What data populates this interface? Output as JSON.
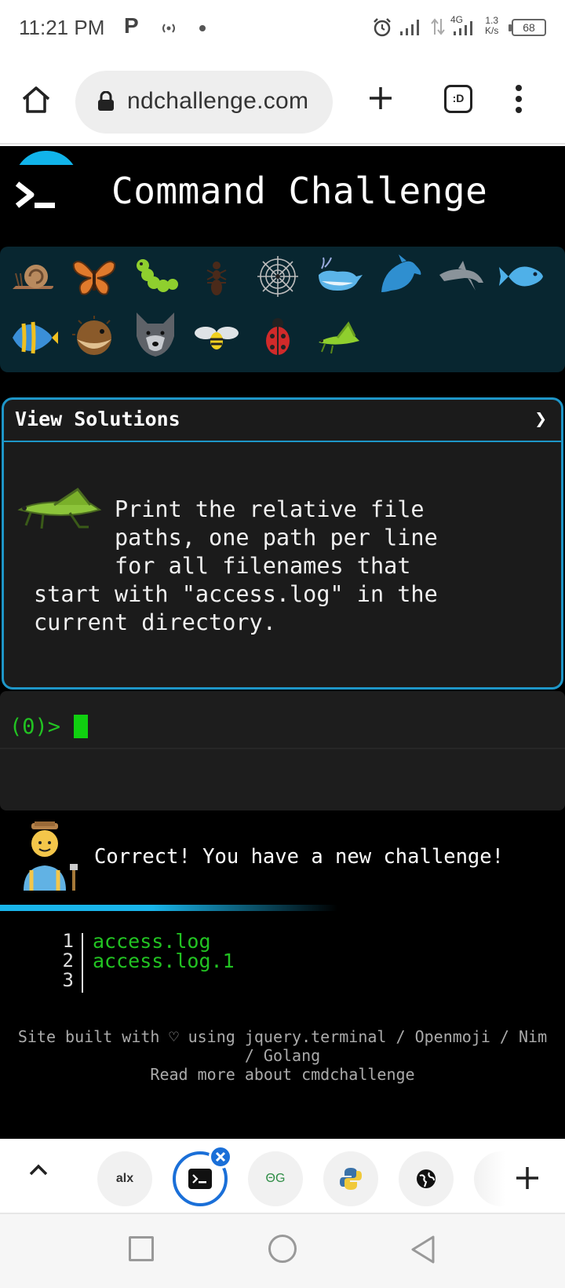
{
  "status_bar": {
    "time": "11:21 PM",
    "p_icon": "P",
    "network": "4G",
    "speed_value": "1.3",
    "speed_unit": "K/s",
    "battery": "68"
  },
  "browser": {
    "url": "ndchallenge.com",
    "tab_switcher": ":D"
  },
  "site": {
    "title": "Command Challenge",
    "animals": [
      "snail",
      "butterfly",
      "caterpillar",
      "ant",
      "spider-web",
      "whale",
      "dolphin-blue",
      "dolphin-gray",
      "fish",
      "tropical-fish",
      "blowfish",
      "wolf",
      "bee",
      "ladybug",
      "grasshopper"
    ],
    "solutions_label": "View Solutions",
    "solutions_chevron": "❯",
    "challenge_text": "      Print the relative file\n      paths, one path per line\n      for all filenames that\nstart with \"access.log\" in the\ncurrent directory.",
    "prompt": "(0)>",
    "feedback": "Correct! You have a new challenge!",
    "output_numbers": "1\n2\n3",
    "output_lines": "access.log\naccess.log.1",
    "footer_line1": "Site built with ♡ using jquery.terminal / Openmoji / Nim",
    "footer_line2": "/ Golang",
    "footer_line3": "Read more about cmdchallenge"
  },
  "tab_strip": {
    "tabs": [
      "alx",
      "terminal",
      "geeksforgeeks",
      "python",
      "globe"
    ],
    "alx_label": "alx",
    "gg_label": "ΘG"
  },
  "colors": {
    "accent": "#1e96c8",
    "terminal_green": "#22c322",
    "active_tab": "#1a6fd8"
  }
}
